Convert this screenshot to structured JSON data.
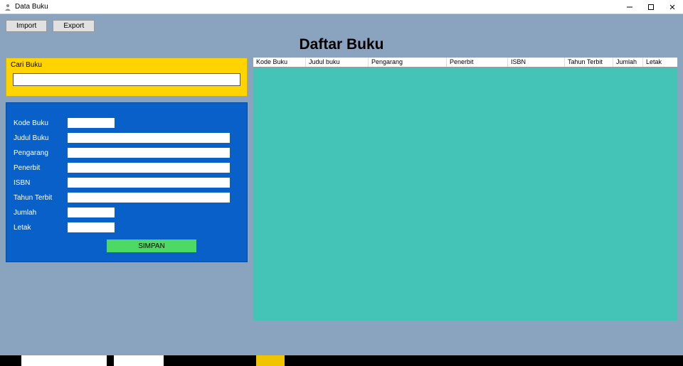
{
  "window": {
    "title": "Data Buku"
  },
  "toolbar": {
    "import": "Import",
    "export": "Export"
  },
  "heading": "Daftar Buku",
  "search": {
    "label": "Cari Buku",
    "value": ""
  },
  "form": {
    "fields": {
      "kode": {
        "label": "Kode Buku",
        "value": ""
      },
      "judul": {
        "label": "Judul Buku",
        "value": ""
      },
      "pengarang": {
        "label": "Pengarang",
        "value": ""
      },
      "penerbit": {
        "label": "Penerbit",
        "value": ""
      },
      "isbn": {
        "label": "ISBN",
        "value": ""
      },
      "tahun": {
        "label": "Tahun Terbit",
        "value": ""
      },
      "jumlah": {
        "label": "Jumlah",
        "value": ""
      },
      "letak": {
        "label": "Letak",
        "value": ""
      }
    },
    "saveLabel": "SIMPAN"
  },
  "table": {
    "columns": [
      "Kode Buku",
      "Judul buku",
      "Pengarang",
      "Penerbit",
      "ISBN",
      "Tahun Terbit",
      "Jumlah",
      "Letak"
    ],
    "rows": []
  }
}
